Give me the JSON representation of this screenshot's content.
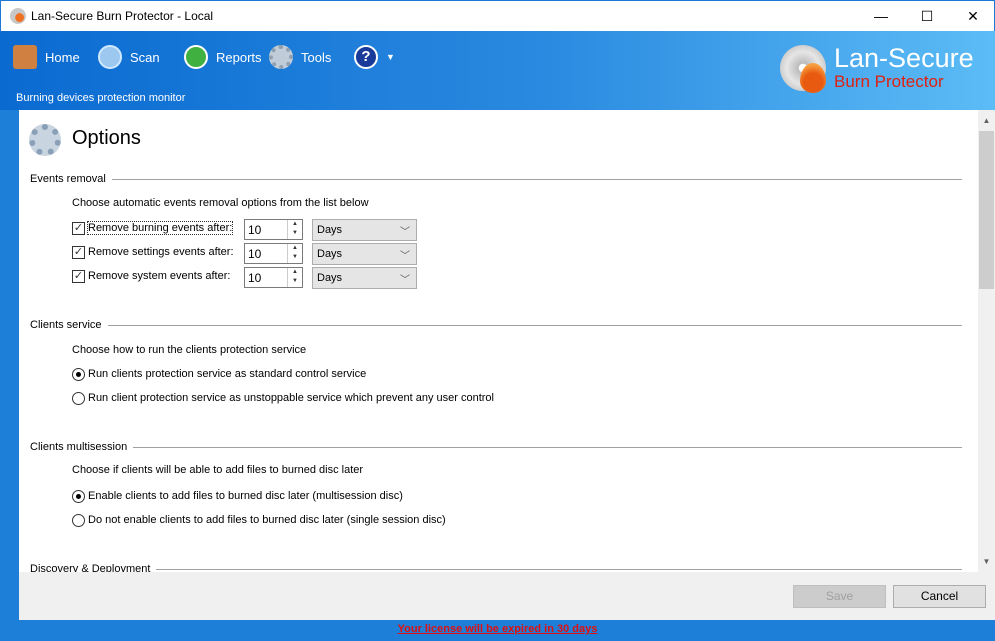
{
  "window": {
    "title": "Lan-Secure Burn Protector - Local",
    "minimize": "—",
    "maximize": "☐",
    "close": "✕"
  },
  "nav": [
    {
      "label": "Home",
      "icon": "home-icon"
    },
    {
      "label": "Scan",
      "icon": "magnifier-icon"
    },
    {
      "label": "Reports",
      "icon": "reports-icon"
    },
    {
      "label": "Tools",
      "icon": "gear-icon"
    },
    {
      "label": "?",
      "icon": "help-icon"
    }
  ],
  "header": {
    "subtitle": "Burning devices protection monitor",
    "logo_line1": "Lan-Secure",
    "logo_line2": "Burn Protector"
  },
  "page": {
    "title": "Options"
  },
  "events": {
    "heading": "Events removal",
    "desc": "Choose automatic events removal options from the list below",
    "rows": [
      {
        "label": "Remove burning events after:",
        "checked": true,
        "value": "10",
        "unit": "Days"
      },
      {
        "label": "Remove settings events after:",
        "checked": true,
        "value": "10",
        "unit": "Days"
      },
      {
        "label": "Remove system events after:",
        "checked": true,
        "value": "10",
        "unit": "Days"
      }
    ]
  },
  "service": {
    "heading": "Clients service",
    "desc": "Choose how to run the clients protection service",
    "opt1": "Run clients protection service as standard control service",
    "opt2": "Run client protection service as unstoppable service which prevent any user control",
    "selected": 1
  },
  "multisession": {
    "heading": "Clients multisession",
    "desc": "Choose if clients will be able to add files to burned disc later",
    "opt1": "Enable clients to add files to burned disc later (multisession disc)",
    "opt2": "Do not enable clients to add files to burned disc later (single session disc)",
    "selected": 1
  },
  "discovery": {
    "heading": "Discovery & Deployment"
  },
  "buttons": {
    "save": "Save",
    "cancel": "Cancel"
  },
  "footer": "Your license will be expired in 30 days"
}
